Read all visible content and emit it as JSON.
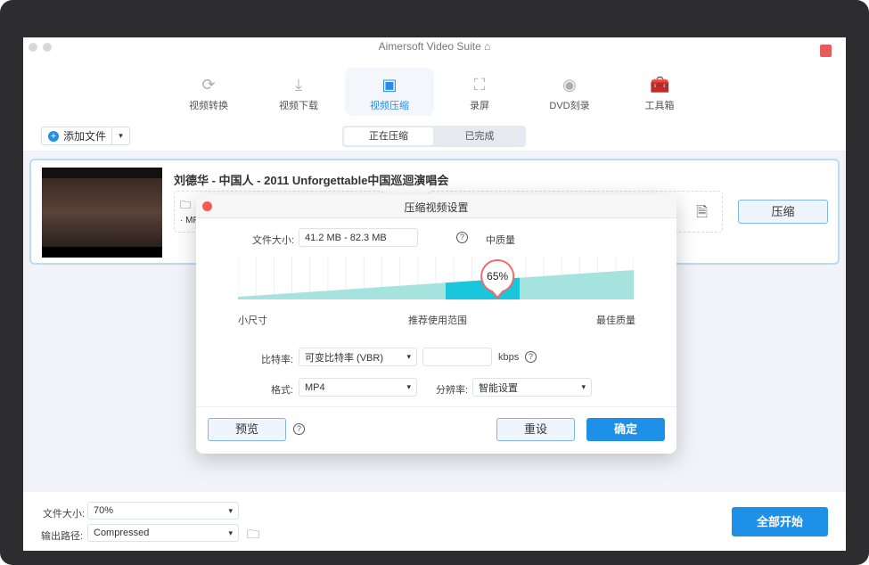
{
  "app": {
    "title": "Aimersoft Video Suite"
  },
  "nav": [
    {
      "label": "视频转换",
      "icon": "convert-icon"
    },
    {
      "label": "视频下载",
      "icon": "download-icon"
    },
    {
      "label": "视频压缩",
      "icon": "compress-icon",
      "active": true
    },
    {
      "label": "录屏",
      "icon": "screen-record-icon"
    },
    {
      "label": "DVD刻录",
      "icon": "dvd-icon"
    },
    {
      "label": "工具箱",
      "icon": "toolbox-icon"
    }
  ],
  "toolbar": {
    "add_file": "添加文件",
    "tabs": [
      "正在压缩",
      "已完成"
    ]
  },
  "file": {
    "title": "刘德华 - 中国人 - 2011 Unforgettable中国巡迴演唱会",
    "format_partial": "· MP",
    "compress_button": "压缩"
  },
  "dialog": {
    "title": "压缩视频设置",
    "file_size_label": "文件大小:",
    "file_size_value": "41.2 MB - 82.3 MB",
    "quality": "中质量",
    "percent": 65,
    "percent_label": "65%",
    "slider_labels": [
      "小尺寸",
      "推荐使用范围",
      "最佳质量"
    ],
    "bitrate_label": "比特率:",
    "bitrate_value": "可变比特率 (VBR)",
    "kbps_value": "",
    "kbps_unit": "kbps",
    "format_label": "格式:",
    "format_value": "MP4",
    "resolution_label": "分辨率:",
    "resolution_value": "智能设置",
    "preview": "预览",
    "reset": "重设",
    "ok": "确定"
  },
  "bottom": {
    "file_size_label": "文件大小:",
    "file_size_value": "70%",
    "output_label": "输出路径:",
    "output_value": "Compressed",
    "start_all": "全部开始"
  },
  "colors": {
    "accent": "#1e90e8",
    "slider": "#a6e3df",
    "slider_range": "#19c6dc",
    "marker": "#f06a6a"
  }
}
